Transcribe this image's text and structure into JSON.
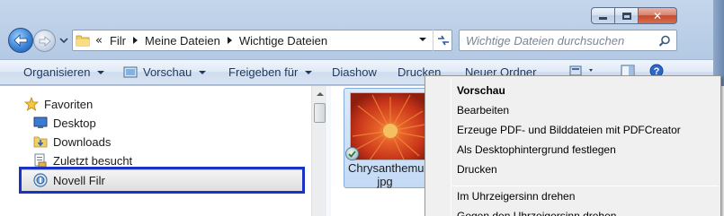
{
  "window": {
    "caption_buttons": {
      "minimize": "minimize-icon",
      "maximize": "maximize-icon",
      "close": "close-icon"
    }
  },
  "address_bar": {
    "overflow": "«",
    "crumbs": [
      "Filr",
      "Meine Dateien",
      "Wichtige Dateien"
    ]
  },
  "search": {
    "placeholder": "Wichtige Dateien durchsuchen"
  },
  "toolbar": {
    "organize": "Organisieren",
    "preview": "Vorschau",
    "share": "Freigeben für",
    "slideshow": "Diashow",
    "print": "Drucken",
    "new_folder": "Neuer Ordner"
  },
  "nav_pane": {
    "favorites": "Favoriten",
    "items": [
      "Desktop",
      "Downloads",
      "Zuletzt besucht"
    ],
    "selected": "Novell Filr"
  },
  "file": {
    "name_line1": "Chrysanthemum",
    "name_line2": "jpg"
  },
  "context_menu": {
    "items": [
      "Vorschau",
      "Bearbeiten",
      "Erzeuge PDF- und Bilddateien mit PDFCreator",
      "Als Desktophintergrund festlegen",
      "Drucken",
      "Im Uhrzeigersinn drehen",
      "Gegen den Uhrzeigersinn drehen"
    ]
  },
  "colors": {
    "focus_rect": "#1a33c4",
    "selection_tile": "#c4daf5",
    "flower": "#d8481a"
  }
}
